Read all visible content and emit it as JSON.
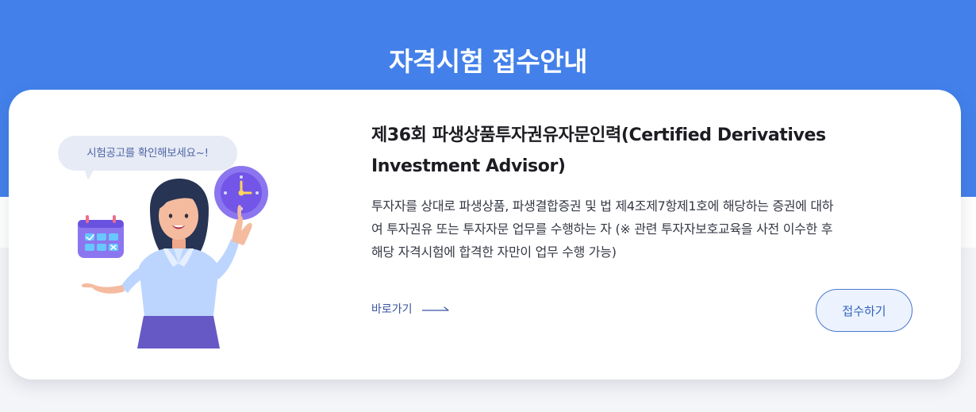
{
  "page": {
    "title": "자격시험 접수안내"
  },
  "card": {
    "bubble_text": "시험공고를 확인해보세요~!",
    "exam_title_line1": "제36회 파생상품투자권유자문인력(Certified Derivatives",
    "exam_title_line2": "Investment Advisor)",
    "description_line1": "투자자를 상대로 파생상품, 파생결합증권 및 법 제4조제7항제1호에 해당하는 증권에 대하",
    "description_line2": "여 투자권유 또는 투자자문 업무를 수행하는 자 (※ 관련 투자자보호교육을 사전 이수한 후",
    "description_line3": "해당 자격시험에 합격한 자만이 업무 수행 가능)",
    "shortcut_label": "바로가기",
    "apply_label": "접수하기"
  },
  "icons": {
    "clock": "clock-icon",
    "calendar": "calendar-icon",
    "arrow": "arrow-right-icon",
    "character": "woman-character-icon"
  },
  "colors": {
    "hero": "#4380ea",
    "button_border": "#4a79d0",
    "button_bg": "#edf3fe",
    "link": "#3953a0",
    "bubble_bg": "#e7ebf5",
    "bubble_text": "#4c64a6"
  }
}
